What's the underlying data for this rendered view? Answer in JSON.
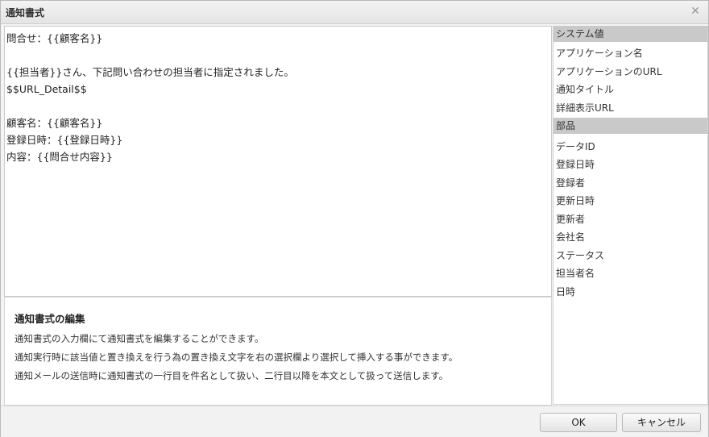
{
  "dialog": {
    "title": "通知書式"
  },
  "editor": {
    "text": "問合せ：{{顧客名}}\n\n{{担当者}}さん、下記問い合わせの担当者に指定されました。\n$$URL_Detail$$\n\n顧客名：{{顧客名}}\n登録日時：{{登録日時}}\n内容：{{問合せ内容}}"
  },
  "help": {
    "title": "通知書式の編集",
    "lines": [
      "通知書式の入力欄にて通知書式を編集することができます。",
      "通知実行時に該当値と置き換えを行う為の置き換え文字を右の選択欄より選択して挿入する事ができます。",
      "通知メールの送信時に通知書式の一行目を件名として扱い、二行目以降を本文として扱って送信します。"
    ]
  },
  "sidebar": {
    "system_header": "システム値",
    "system_items": [
      "アプリケーション名",
      "アプリケーションのURL",
      "通知タイトル",
      "詳細表示URL"
    ],
    "parts_header": "部品",
    "parts_items": [
      "データID",
      "登録日時",
      "登録者",
      "更新日時",
      "更新者",
      "会社名",
      "ステータス",
      "担当者名",
      "日時"
    ]
  },
  "footer": {
    "ok_label": "OK",
    "cancel_label": "キャンセル"
  },
  "icons": {
    "close": "close-icon"
  }
}
